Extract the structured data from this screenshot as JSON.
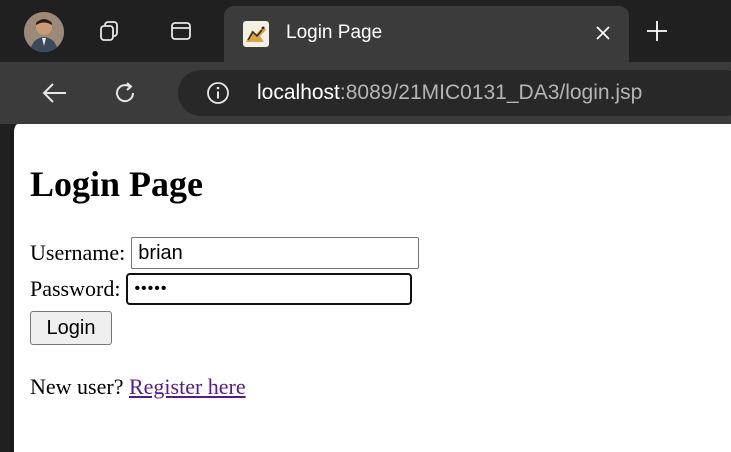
{
  "browser": {
    "tab": {
      "title": "Login Page",
      "favicon": "tomcat-icon"
    },
    "toolbar": {
      "back": "back-arrow-icon",
      "reload": "reload-icon",
      "site_info": "info-icon"
    },
    "address": {
      "host": "localhost",
      "path": ":8089/21MIC0131_DA3/login.jsp"
    }
  },
  "page": {
    "title": "Login Page",
    "username_label": "Username:",
    "username_value": "brian",
    "password_label": "Password:",
    "password_masked": "•••••",
    "login_button": "Login",
    "new_user_text": "New user?",
    "register_link": "Register here"
  },
  "colors": {
    "chrome_dark": "#202020",
    "toolbar": "#3b3b3b",
    "link_visited": "#551a8b"
  }
}
